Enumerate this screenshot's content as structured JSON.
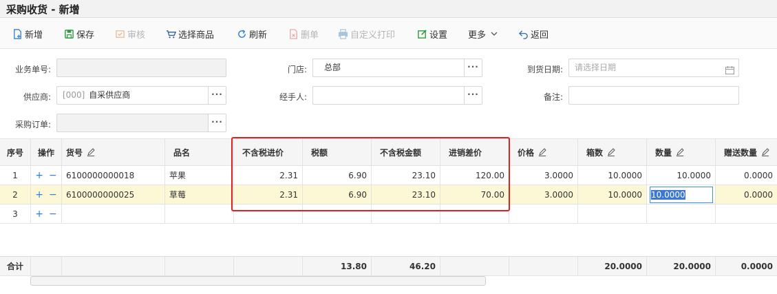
{
  "title": "采购收货 - 新增",
  "toolbar": {
    "new": "新增",
    "save": "保存",
    "audit": "审核",
    "select_goods": "选择商品",
    "refresh": "刷新",
    "delete": "删单",
    "custom_print": "自定义打印",
    "settings": "设置",
    "more": "更多",
    "back": "返回"
  },
  "form": {
    "order_no_label": "业务单号:",
    "order_no_value": "",
    "store_label": "门店:",
    "store_value": "总部",
    "arrival_label": "到货日期:",
    "arrival_placeholder": "请选择日期",
    "supplier_label": "供应商:",
    "supplier_code": "[000]",
    "supplier_name": "自采供应商",
    "handler_label": "经手人:",
    "handler_value": "",
    "remark_label": "备注:",
    "remark_value": "",
    "po_label": "采购订单:",
    "po_value": "",
    "ellipsis": "···"
  },
  "table": {
    "headers": {
      "seq": "序号",
      "op": "操作",
      "code": "货号",
      "name": "品名",
      "price_ex_tax": "不含税进价",
      "tax": "税额",
      "amount_ex_tax": "不含税金额",
      "margin": "进销差价",
      "price": "价格",
      "boxes": "箱数",
      "qty": "数量",
      "gift_qty": "赠送数量"
    },
    "op_add": "+",
    "op_remove": "−",
    "rows": [
      {
        "seq": "1",
        "code": "6100000000018",
        "name": "苹果",
        "price_ex_tax": "2.31",
        "tax": "6.90",
        "amount_ex_tax": "23.10",
        "margin": "120.00",
        "price": "3.0000",
        "boxes": "10.0000",
        "qty": "10.0000",
        "gift_qty": "0.0000"
      },
      {
        "seq": "2",
        "code": "6100000000025",
        "name": "草莓",
        "price_ex_tax": "2.31",
        "tax": "6.90",
        "amount_ex_tax": "23.10",
        "margin": "70.00",
        "price": "3.0000",
        "boxes": "10.0000",
        "qty": "10.0000",
        "gift_qty": "0.0000"
      },
      {
        "seq": "3",
        "code": "",
        "name": "",
        "price_ex_tax": "",
        "tax": "",
        "amount_ex_tax": "",
        "margin": "",
        "price": "",
        "boxes": "",
        "qty": "",
        "gift_qty": ""
      }
    ],
    "totals": {
      "label": "合计",
      "tax": "13.80",
      "amount_ex_tax": "46.20",
      "boxes": "20.0000",
      "qty": "20.0000",
      "gift_qty": "0.0000"
    }
  },
  "colors": {
    "accent": "#2d7fd6",
    "highlight_border": "#e02020",
    "selected_row": "#fcf7d5",
    "save_icon": "#2e9b3e"
  }
}
